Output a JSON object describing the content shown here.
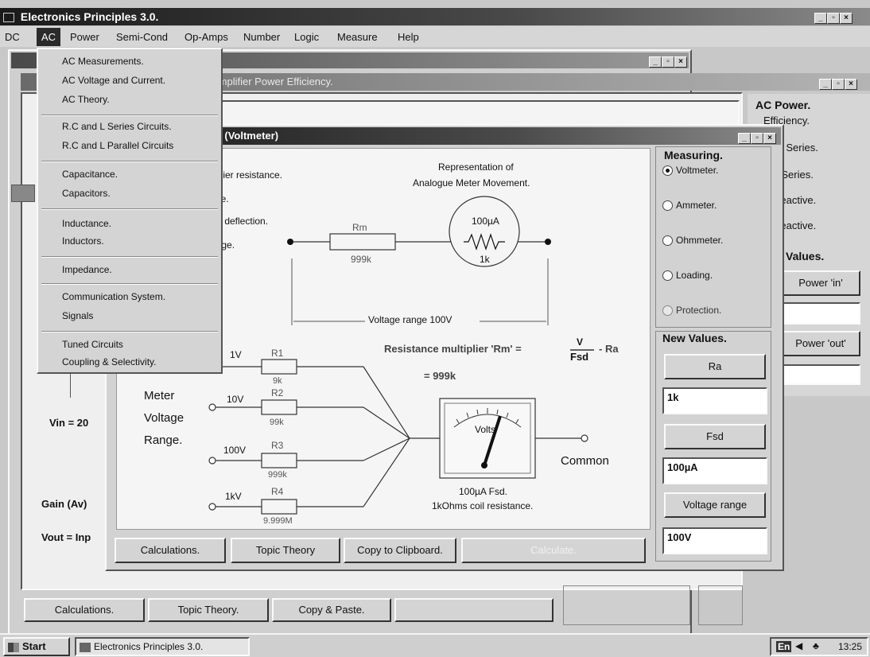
{
  "app": {
    "title": "Electronics Principles 3.0.",
    "menubar": [
      "DC",
      "AC",
      "Power",
      "Semi-Cond",
      "Op-Amps",
      "Number",
      "Logic",
      "Measure",
      "Help"
    ]
  },
  "ac_menu": {
    "groups": [
      [
        "AC Measurements.",
        "AC Voltage and Current.",
        "AC Theory."
      ],
      [
        "R.C and L Series Circuits.",
        "R.C and L Parallel Circuits"
      ],
      [
        "Capacitance.",
        "Capacitors."
      ],
      [
        "Inductance.",
        "Inductors."
      ],
      [
        "Impedance."
      ],
      [
        "Communication System.",
        "Signals"
      ],
      [
        "Tuned Circuits",
        "Coupling & Selectivity."
      ]
    ]
  },
  "back_window": {
    "title": "Amplifier Power Efficiency.",
    "vin": "Vin = 20",
    "gain": "Gain (Av)",
    "vout": "Vout = Inp",
    "buttons": [
      "Calculations.",
      "Topic Theory.",
      "Copy & Paste."
    ]
  },
  "ac_power_panel": {
    "title": "AC Power.",
    "items": [
      "Efficiency.",
      "RC Series.",
      "L Series.",
      "Reactive.",
      "Reactive."
    ],
    "values_title": "Values.",
    "buttons": [
      "Power 'in'",
      "Power 'out'"
    ]
  },
  "voltmeter_window": {
    "title": "ge. (Voltmeter)",
    "left_text": [
      "tiplier resistance.",
      "nce.",
      "ter deflection.",
      "ange."
    ],
    "representation": [
      "Representation of",
      "Analogue Meter Movement."
    ],
    "rm_label": "Rm",
    "rm_value": "999k",
    "meter_current": "100µA",
    "meter_res": "1k",
    "voltage_range": "Voltage range  100V",
    "formula_prefix": "Resistance multiplier 'Rm' =",
    "formula_num": "V",
    "formula_den": "Fsd",
    "formula_suffix": "- Ra",
    "formula_result": "= 999k",
    "range_label": [
      "Meter",
      "Voltage",
      "Range."
    ],
    "ranges": [
      {
        "v": "1V",
        "r": "R1",
        "val": "9k"
      },
      {
        "v": "10V",
        "r": "R2",
        "val": "99k"
      },
      {
        "v": "100V",
        "r": "R3",
        "val": "999k"
      },
      {
        "v": "1kV",
        "r": "R4",
        "val": "9.999M"
      }
    ],
    "meter_face": "Volts",
    "common": "Common",
    "meter_caption": [
      "100µA Fsd.",
      "1kOhms coil resistance."
    ],
    "buttons": [
      "Calculations.",
      "Topic Theory",
      "Copy to Clipboard.",
      "Calculate."
    ],
    "measuring_title": "Measuring.",
    "measuring_options": [
      "Voltmeter.",
      "Ammeter.",
      "Ohmmeter.",
      "Loading.",
      "Protection."
    ],
    "new_values_title": "New Values.",
    "ra_button": "Ra",
    "ra_value": "1k",
    "fsd_button": "Fsd",
    "fsd_value": "100µA",
    "vr_button": "Voltage range",
    "vr_value": "100V"
  },
  "taskbar": {
    "start": "Start",
    "task": "Electronics Principles 3.0.",
    "tray_lang": "En",
    "time": "13:25"
  }
}
